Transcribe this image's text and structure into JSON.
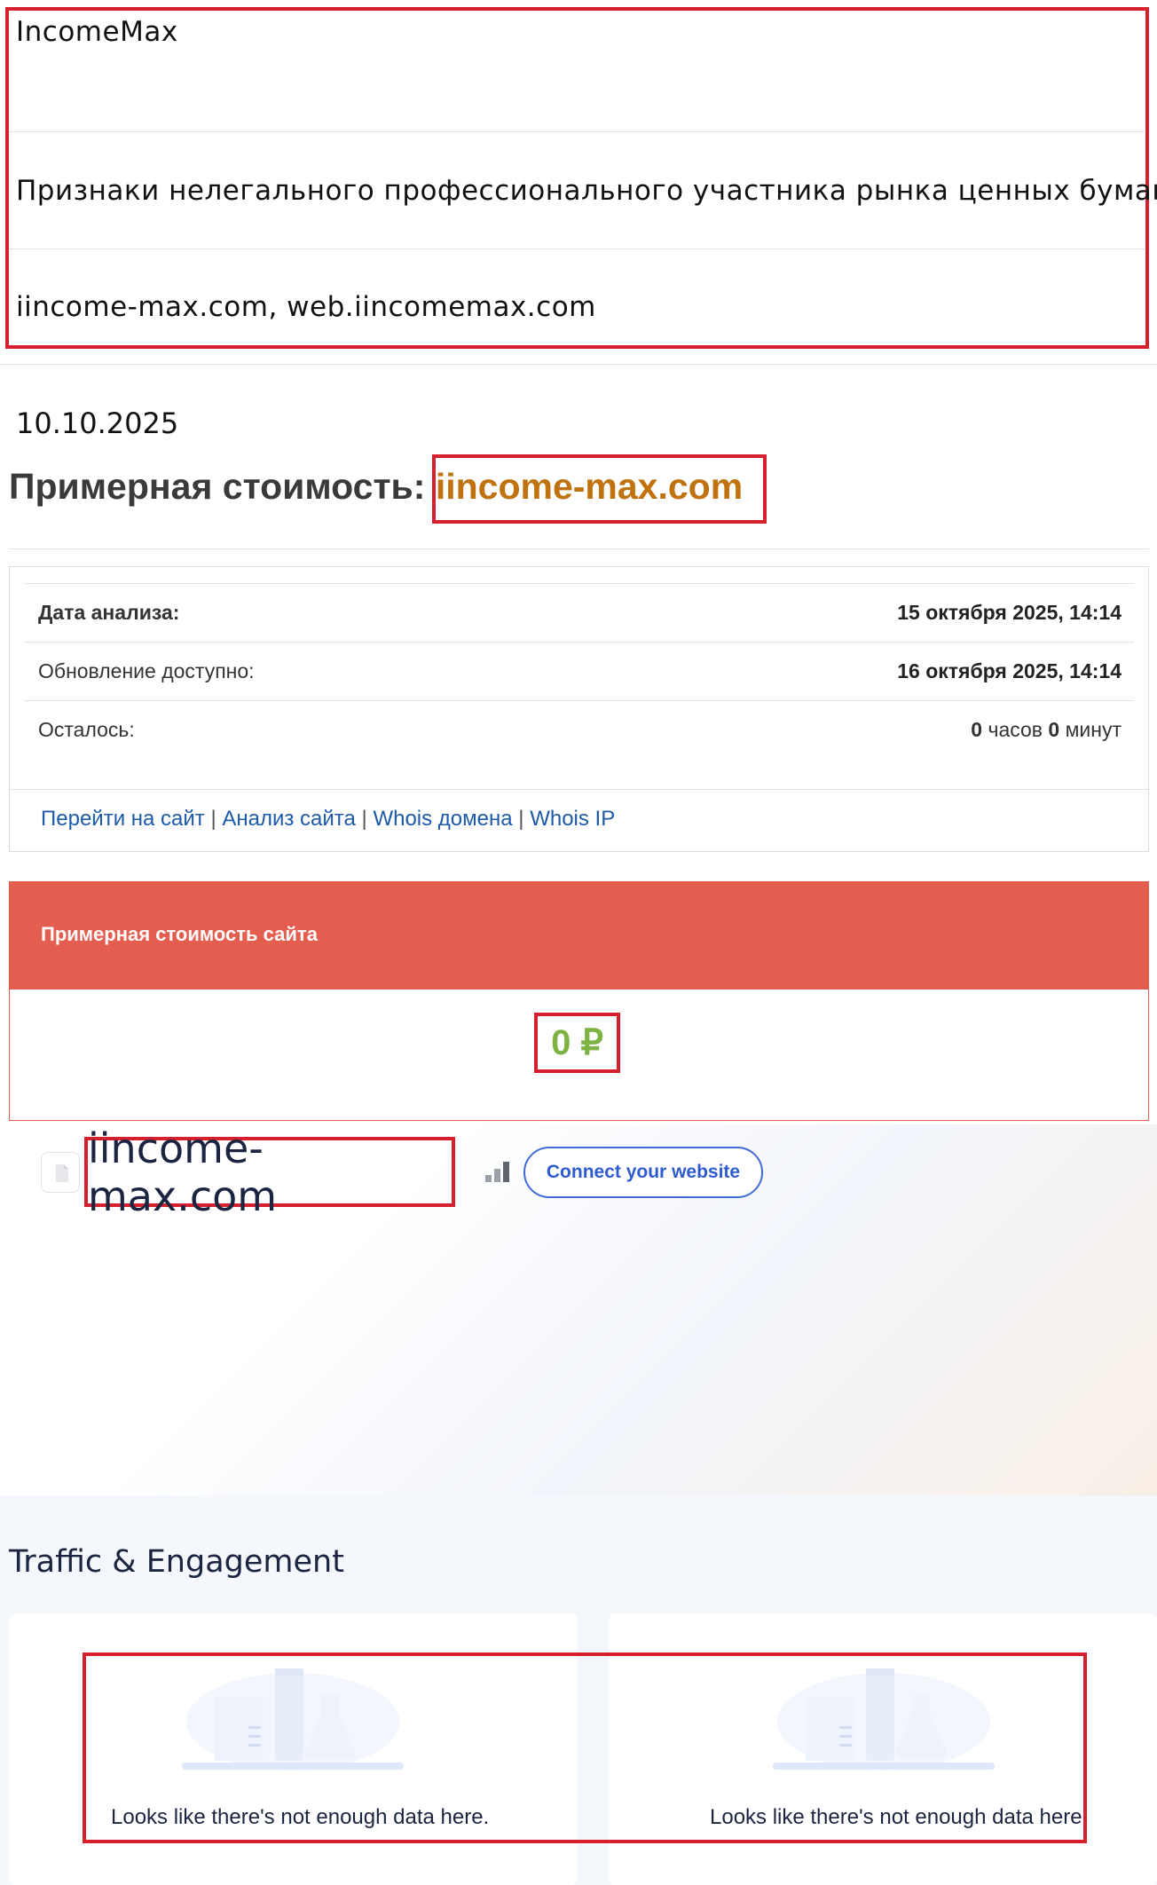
{
  "record": {
    "name": "IncomeMax",
    "category": "Признаки нелегального профессионального участника рынка ценных бумаг",
    "domains": "iincome-max.com, web.iincomemax.com"
  },
  "price_page": {
    "date": "10.10.2025",
    "title_prefix": "Примерная стоимость:",
    "title_domain": "iincome-max.com",
    "rows": [
      {
        "label": "Дата анализа:",
        "value": "15 октября 2025, 14:14"
      },
      {
        "label": "Обновление доступно:",
        "value": "16 октября 2025, 14:14"
      }
    ],
    "remaining": {
      "label": "Осталось:",
      "hours": "0",
      "hours_unit": "часов",
      "minutes": "0",
      "minutes_unit": "минут"
    },
    "links": [
      "Перейти на сайт",
      "Анализ сайта",
      "Whois домена",
      "Whois IP"
    ],
    "value_header": "Примерная стоимость сайта",
    "value": "0 ₽"
  },
  "similarweb": {
    "domain": "iincome-max.com",
    "connect_label": "Connect your website",
    "section_title": "Traffic & Engagement",
    "no_data_left": "Looks like there's not enough data here.",
    "no_data_right": "Looks like there's not enough data here."
  },
  "colors": {
    "highlight_border": "#d6202e",
    "domain_orange": "#c0720f",
    "value_header_bg": "#e35e4e",
    "value_green": "#7cb342",
    "link_blue": "#1d5aa8",
    "connect_blue": "#3f6ad8"
  }
}
